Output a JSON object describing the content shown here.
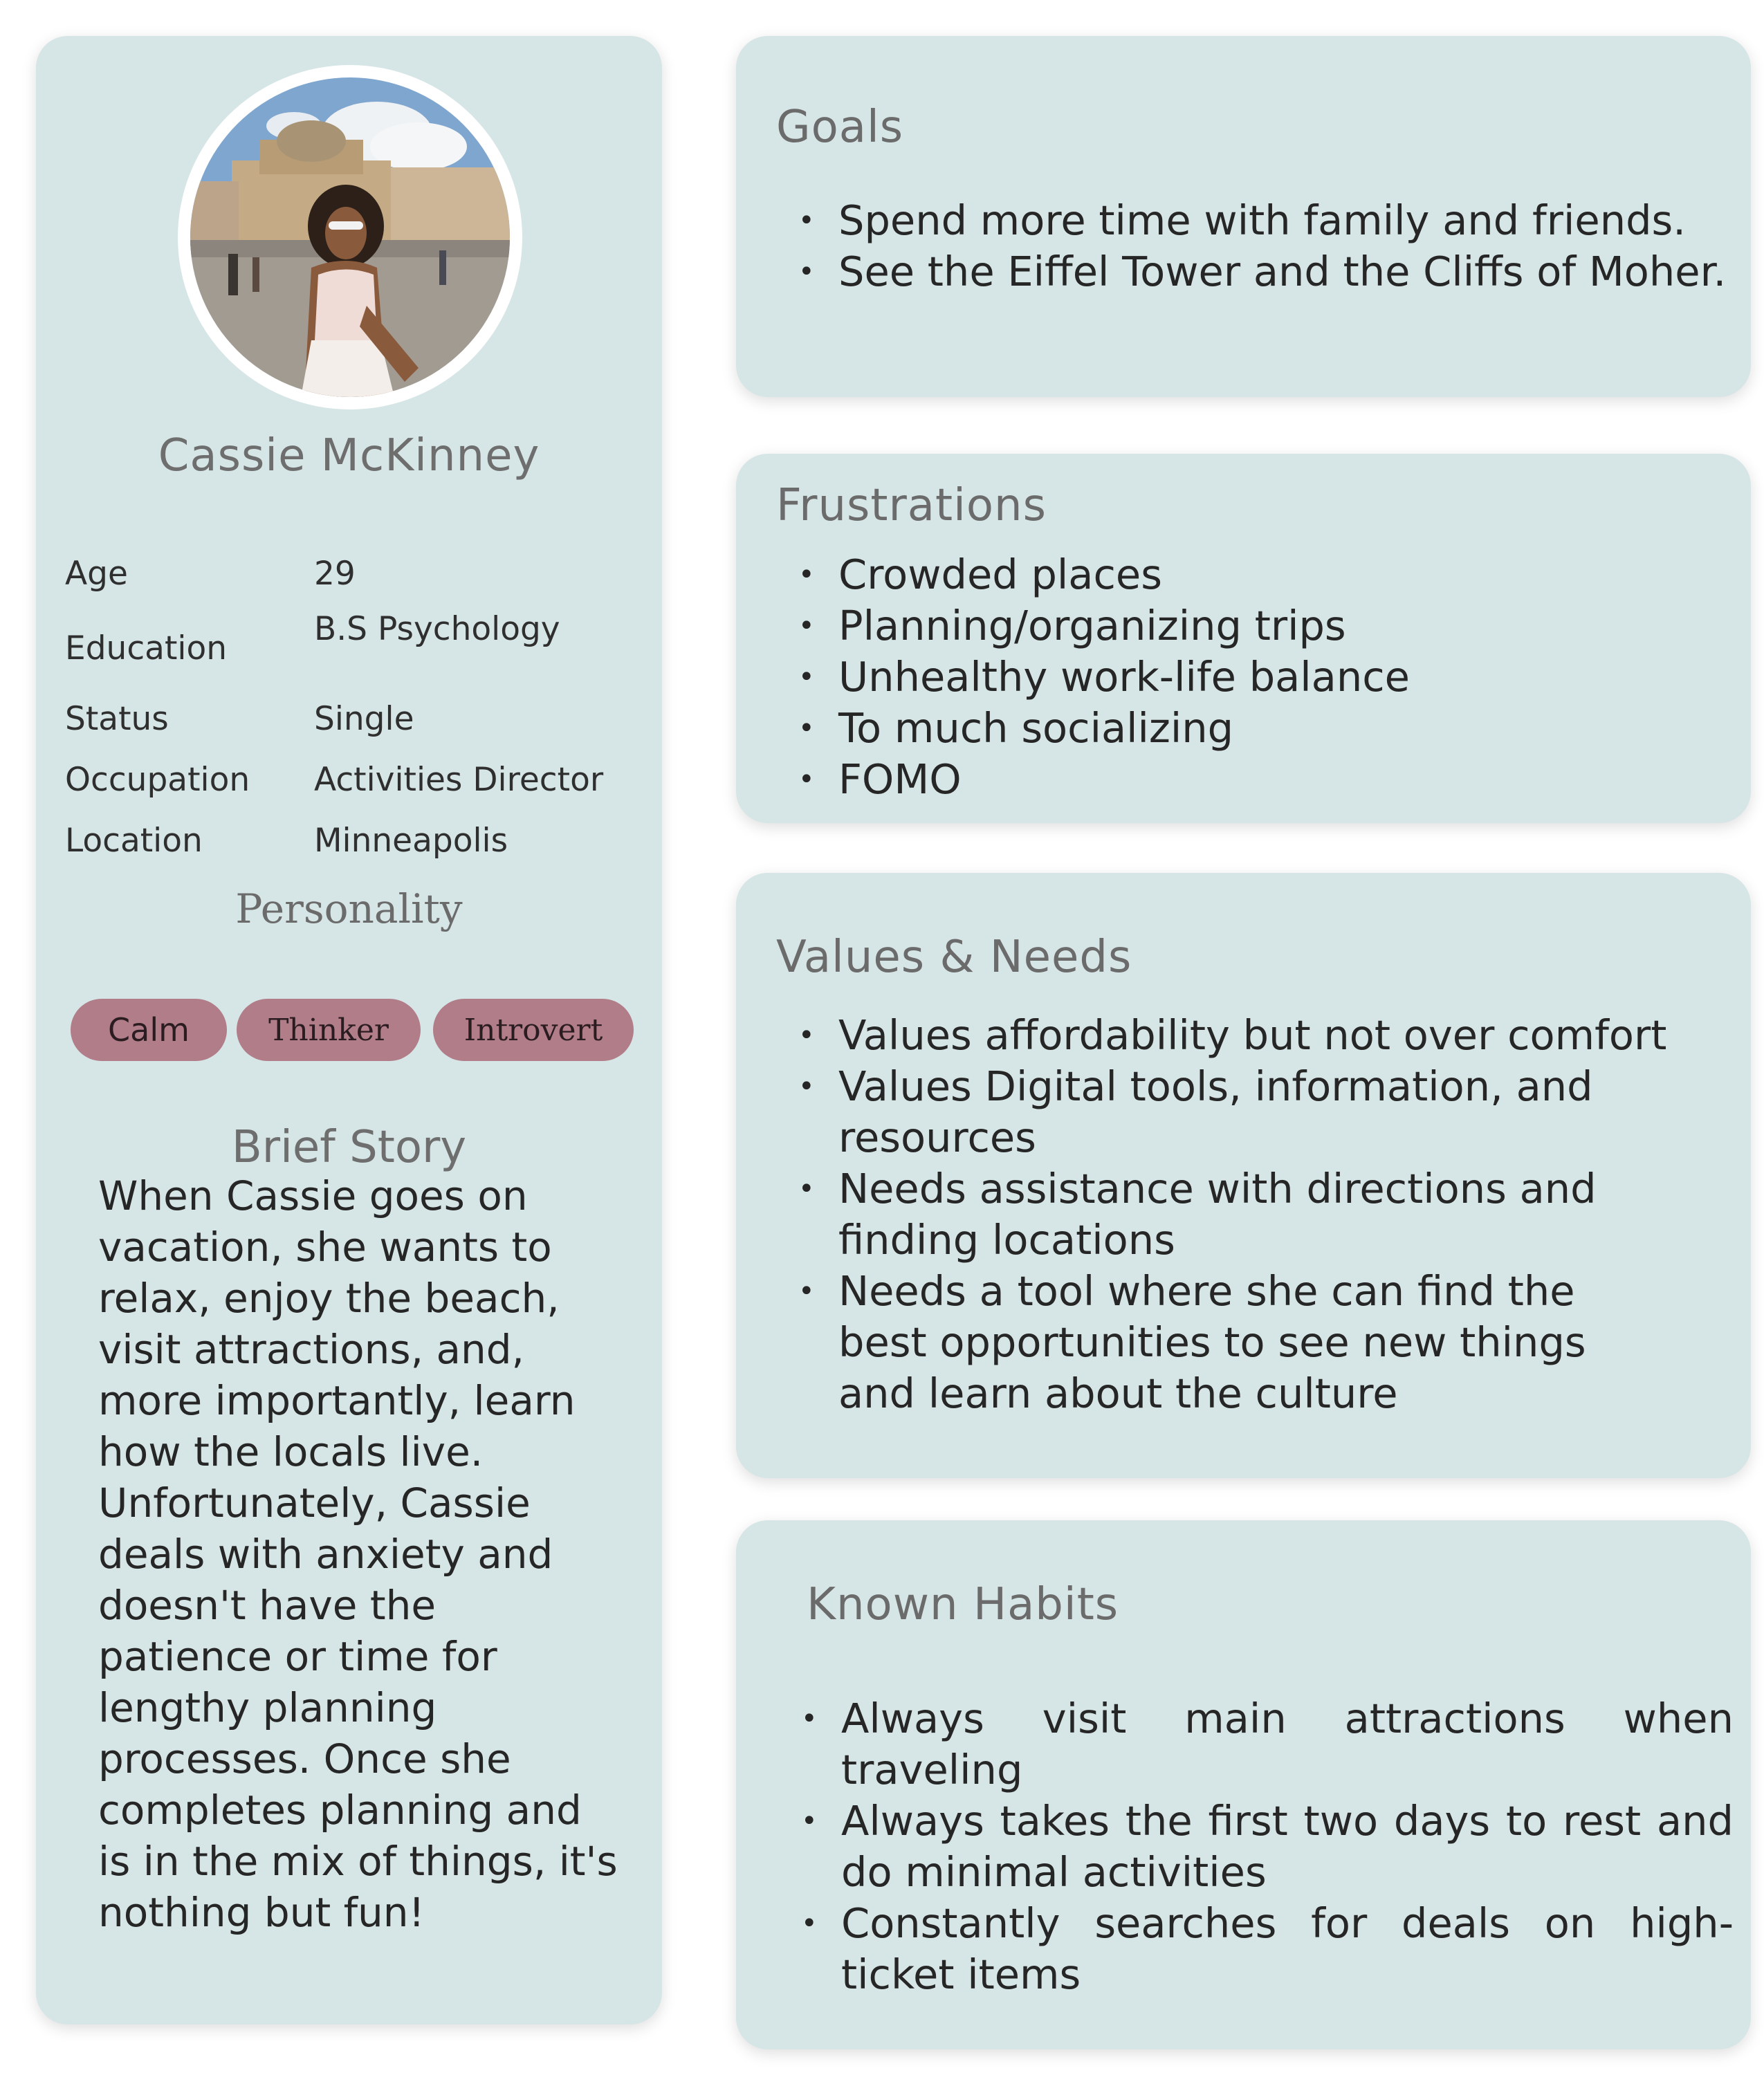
{
  "profile": {
    "name": "Cassie McKinney",
    "details": [
      {
        "label": "Age",
        "value": "29"
      },
      {
        "label": "Education",
        "value": "B.S Psychology"
      },
      {
        "label": "Status",
        "value": "Single"
      },
      {
        "label": "Occupation",
        "value": "Activities Director"
      },
      {
        "label": "Location",
        "value": "Minneapolis"
      }
    ],
    "personality_title": "Personality",
    "traits": [
      "Calm",
      "Thinker",
      "Introvert"
    ],
    "story_title": "Brief Story",
    "story_lines": [
      "When Cassie goes on",
      "vacation, she wants to",
      "relax, enjoy the beach,",
      "visit attractions, and,",
      "more importantly, learn",
      "how the locals live.",
      "Unfortunately, Cassie",
      "deals with anxiety and",
      "doesn't have the",
      "patience or time for",
      "lengthy planning",
      "processes. Once she",
      "completes planning and",
      "is in the mix of things, it's",
      "nothing but fun!"
    ]
  },
  "goals": {
    "title": "Goals",
    "items": [
      "Spend more time with family and friends.",
      "See the Eiffel Tower and the Cliffs of Moher."
    ]
  },
  "frustrations": {
    "title": "Frustrations",
    "items": [
      "Crowded places",
      "Planning/organizing trips",
      "Unhealthy work-life balance",
      "To much socializing",
      "FOMO"
    ]
  },
  "values_needs": {
    "title": "Values & Needs",
    "items": [
      "Values affordability but not over comfort",
      "Values Digital tools, information, and resources",
      "Needs assistance with directions and finding locations",
      "Needs a tool where she can find the best opportunities to see new things and learn about the culture"
    ]
  },
  "habits": {
    "title": "Known Habits",
    "items": [
      "Always visit main attractions when traveling",
      "Always takes the first two days to rest and do minimal activities",
      "Constantly searches for deals on high-ticket items"
    ]
  },
  "colors": {
    "card_background": "#d6e5e5",
    "tag_background": "#b07d88",
    "title_text": "#6b6b6b"
  }
}
